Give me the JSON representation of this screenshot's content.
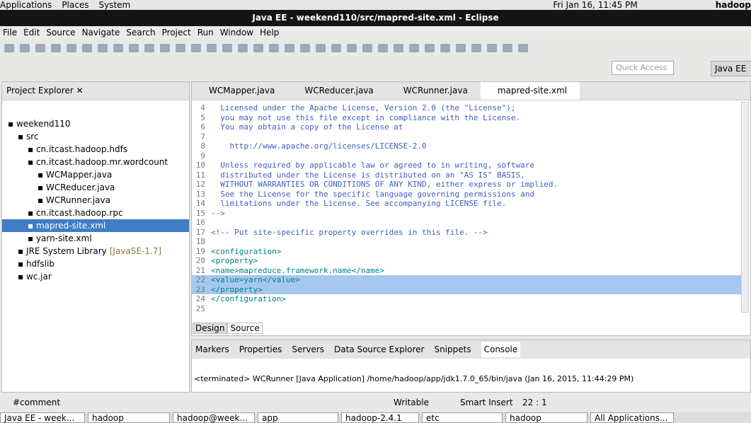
{
  "top_panel": {
    "items": [
      "Applications",
      "Places",
      "System"
    ],
    "clock": "Fri Jan 16, 11:45 PM",
    "user": "hadoop"
  },
  "window_title": "Java EE - weekend110/src/mapred-site.xml - Eclipse",
  "menu": [
    "File",
    "Edit",
    "Source",
    "Navigate",
    "Search",
    "Project",
    "Run",
    "Window",
    "Help"
  ],
  "quick_access_placeholder": "Quick Access",
  "perspective": "Java EE",
  "project_explorer": {
    "title": "Project Explorer",
    "tree": [
      {
        "label": "weekend110",
        "depth": 0,
        "icon": "project-icon"
      },
      {
        "label": "src",
        "depth": 1,
        "icon": "folder-icon"
      },
      {
        "label": "cn.itcast.hadoop.hdfs",
        "depth": 2,
        "icon": "package-icon"
      },
      {
        "label": "cn.itcast.hadoop.mr.wordcount",
        "depth": 2,
        "icon": "package-icon"
      },
      {
        "label": "WCMapper.java",
        "depth": 3,
        "icon": "java-file-icon"
      },
      {
        "label": "WCReducer.java",
        "depth": 3,
        "icon": "java-file-icon"
      },
      {
        "label": "WCRunner.java",
        "depth": 3,
        "icon": "java-file-icon"
      },
      {
        "label": "cn.itcast.hadoop.rpc",
        "depth": 2,
        "icon": "package-icon"
      },
      {
        "label": "mapred-site.xml",
        "depth": 2,
        "icon": "xml-file-icon",
        "selected": true
      },
      {
        "label": "yarn-site.xml",
        "depth": 2,
        "icon": "xml-file-icon"
      },
      {
        "label": "JRE System Library",
        "suffix": "[JavaSE-1.7]",
        "depth": 1,
        "icon": "library-icon"
      },
      {
        "label": "hdfslib",
        "depth": 1,
        "icon": "library-icon"
      },
      {
        "label": "wc.jar",
        "depth": 1,
        "icon": "jar-icon"
      }
    ]
  },
  "editor_tabs": [
    "WCMapper.java",
    "WCReducer.java",
    "WCRunner.java",
    "mapred-site.xml"
  ],
  "active_tab": "mapred-site.xml",
  "code_lines": [
    {
      "n": "4",
      "t": "  Licensed under the Apache License, Version 2.0 (the \"License\");",
      "c": "cm"
    },
    {
      "n": "5",
      "t": "  you may not use this file except in compliance with the License.",
      "c": "cm"
    },
    {
      "n": "6",
      "t": "  You may obtain a copy of the License at",
      "c": "cm"
    },
    {
      "n": "7",
      "t": "",
      "c": "cm"
    },
    {
      "n": "8",
      "t": "    http://www.apache.org/licenses/LICENSE-2.0",
      "c": "cm"
    },
    {
      "n": "9",
      "t": "",
      "c": "cm"
    },
    {
      "n": "10",
      "t": "  Unless required by applicable law or agreed to in writing, software",
      "c": "cm"
    },
    {
      "n": "11",
      "t": "  distributed under the License is distributed on an \"AS IS\" BASIS,",
      "c": "cm"
    },
    {
      "n": "12",
      "t": "  WITHOUT WARRANTIES OR CONDITIONS OF ANY KIND, either express or implied.",
      "c": "cm"
    },
    {
      "n": "13",
      "t": "  See the License for the specific language governing permissions and",
      "c": "cm"
    },
    {
      "n": "14",
      "t": "  limitations under the License. See accompanying LICENSE file.",
      "c": "cm"
    },
    {
      "n": "15",
      "t": "-->",
      "c": "cm"
    },
    {
      "n": "16",
      "t": "",
      "c": ""
    },
    {
      "n": "17",
      "t": "<!-- Put site-specific property overrides in this file. -->",
      "c": "cm"
    },
    {
      "n": "18",
      "t": "",
      "c": ""
    },
    {
      "n": "19",
      "t": "<configuration>",
      "c": "tg"
    },
    {
      "n": "20",
      "t": "<property>",
      "c": "tg"
    },
    {
      "n": "21",
      "t": "<name>mapreduce.framework.name</name>",
      "c": "tg"
    },
    {
      "n": "22",
      "t": "<value>yarn</value>",
      "c": "tg",
      "hl": true
    },
    {
      "n": "23",
      "t": "</property>",
      "c": "tg",
      "hl": true
    },
    {
      "n": "24",
      "t": "</configuration>",
      "c": "tg"
    },
    {
      "n": "25",
      "t": "",
      "c": ""
    }
  ],
  "design_tabs": [
    "Design",
    "Source"
  ],
  "console_tabs": [
    "Markers",
    "Properties",
    "Servers",
    "Data Source Explorer",
    "Snippets",
    "Console"
  ],
  "console_text": "<terminated> WCRunner [Java Application] /home/hadoop/app/jdk1.7.0_65/bin/java (Jan 16, 2015, 11:44:29 PM)",
  "status": {
    "left": "#comment",
    "mode": "Writable",
    "insert": "Smart Insert",
    "pos": "22 : 1"
  },
  "taskbar": [
    "Java EE - week...",
    "hadoop",
    "hadoop@week...",
    "app",
    "hadoop-2.4.1",
    "etc",
    "hadoop",
    "All Applications..."
  ]
}
